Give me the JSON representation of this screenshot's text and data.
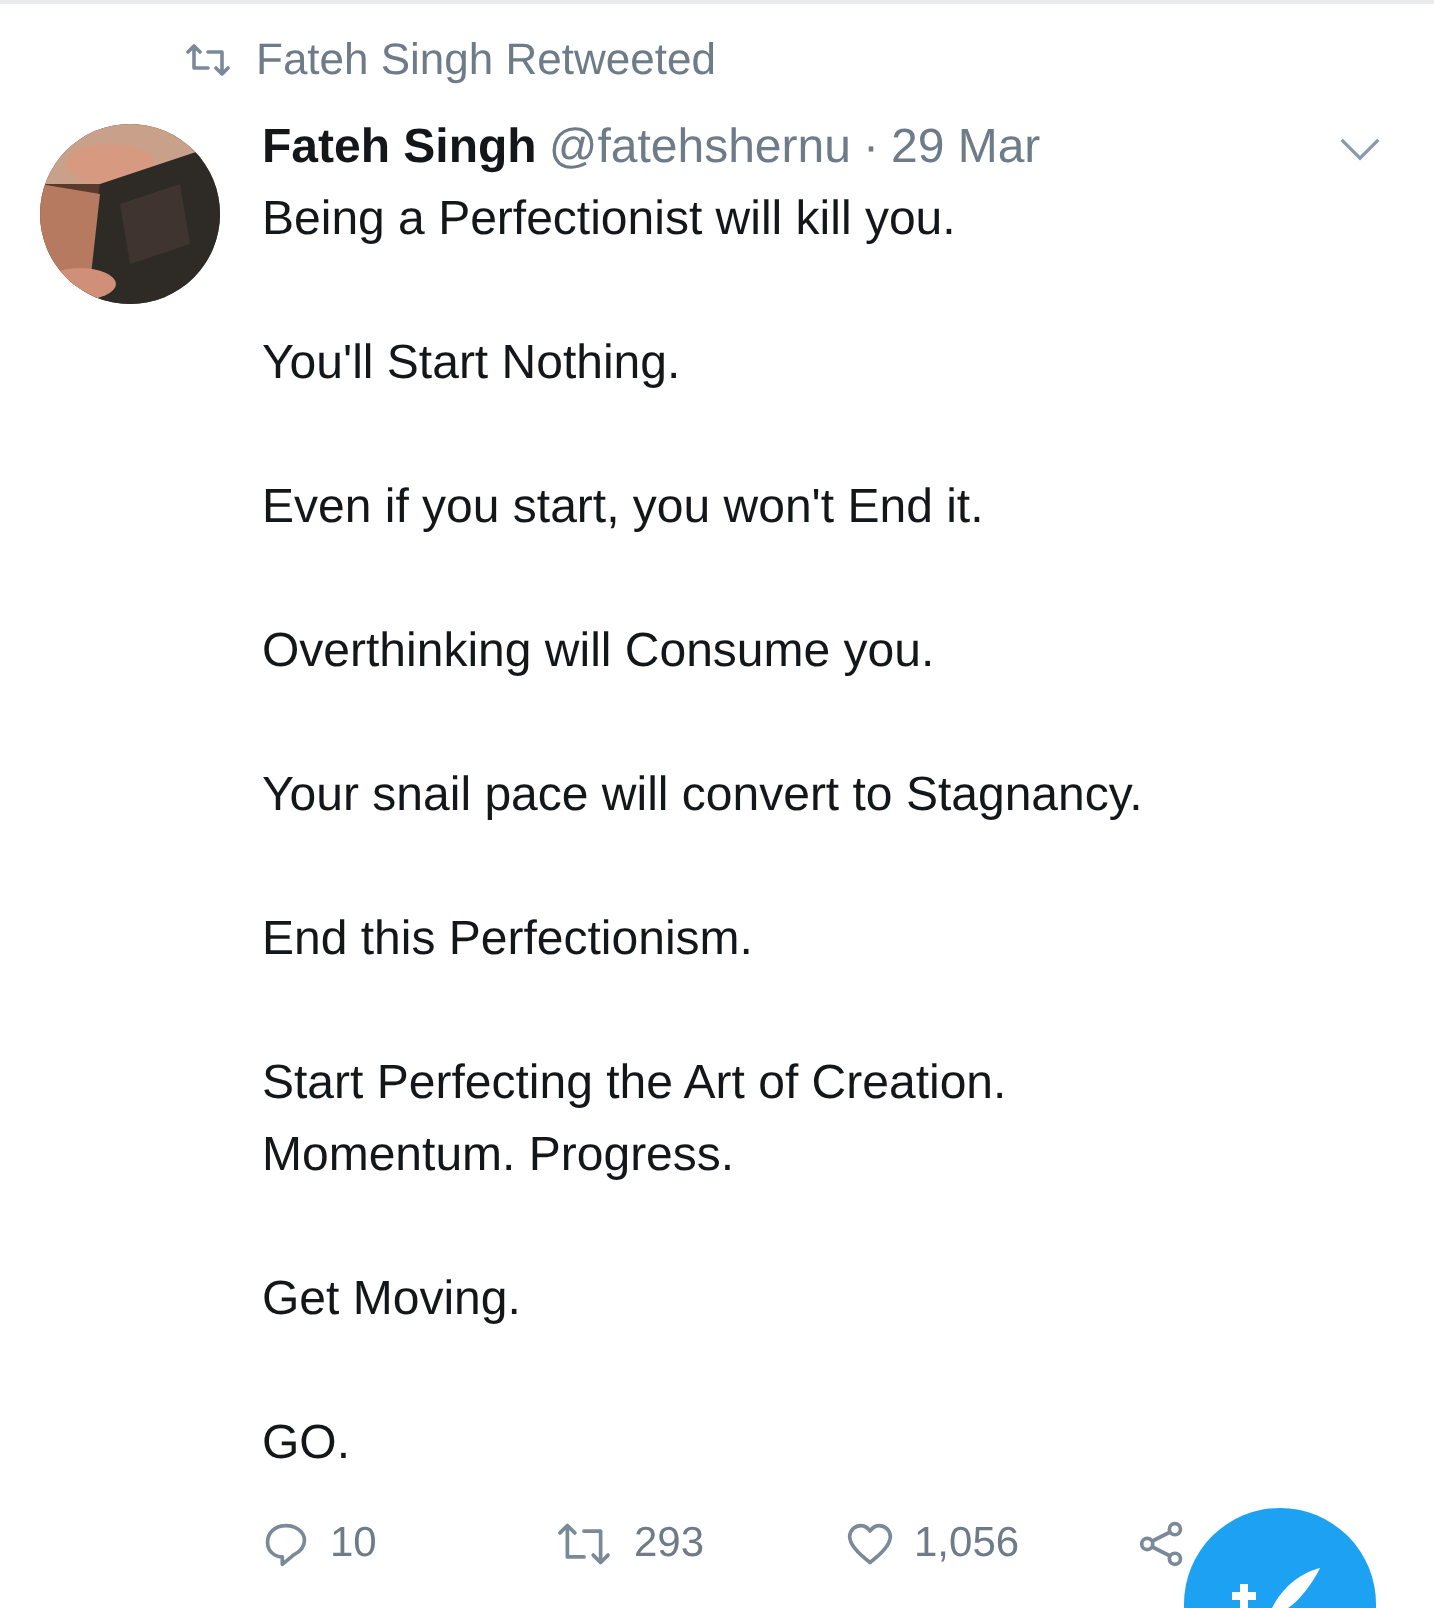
{
  "retweet_banner": {
    "text": "Fateh Singh Retweeted"
  },
  "tweet": {
    "name": "Fateh Singh",
    "handle": "@fatehshernu",
    "separator": "·",
    "date": "29 Mar",
    "paragraphs": [
      "Being a Perfectionist will kill you.",
      "You'll Start Nothing.",
      "Even if you start, you won't End it.",
      "Overthinking will Consume you.",
      "Your snail pace will convert to Stagnancy.",
      "End this Perfectionism.",
      "Start Perfecting the Art of Creation.\nMomentum. Progress.",
      "Get Moving.",
      "GO."
    ],
    "actions": [
      {
        "kind": "reply",
        "count": "10"
      },
      {
        "kind": "retweet",
        "count": "293"
      },
      {
        "kind": "like",
        "count": "1,056"
      },
      {
        "kind": "share"
      }
    ]
  },
  "compose_button": {
    "kind": "fab"
  }
}
